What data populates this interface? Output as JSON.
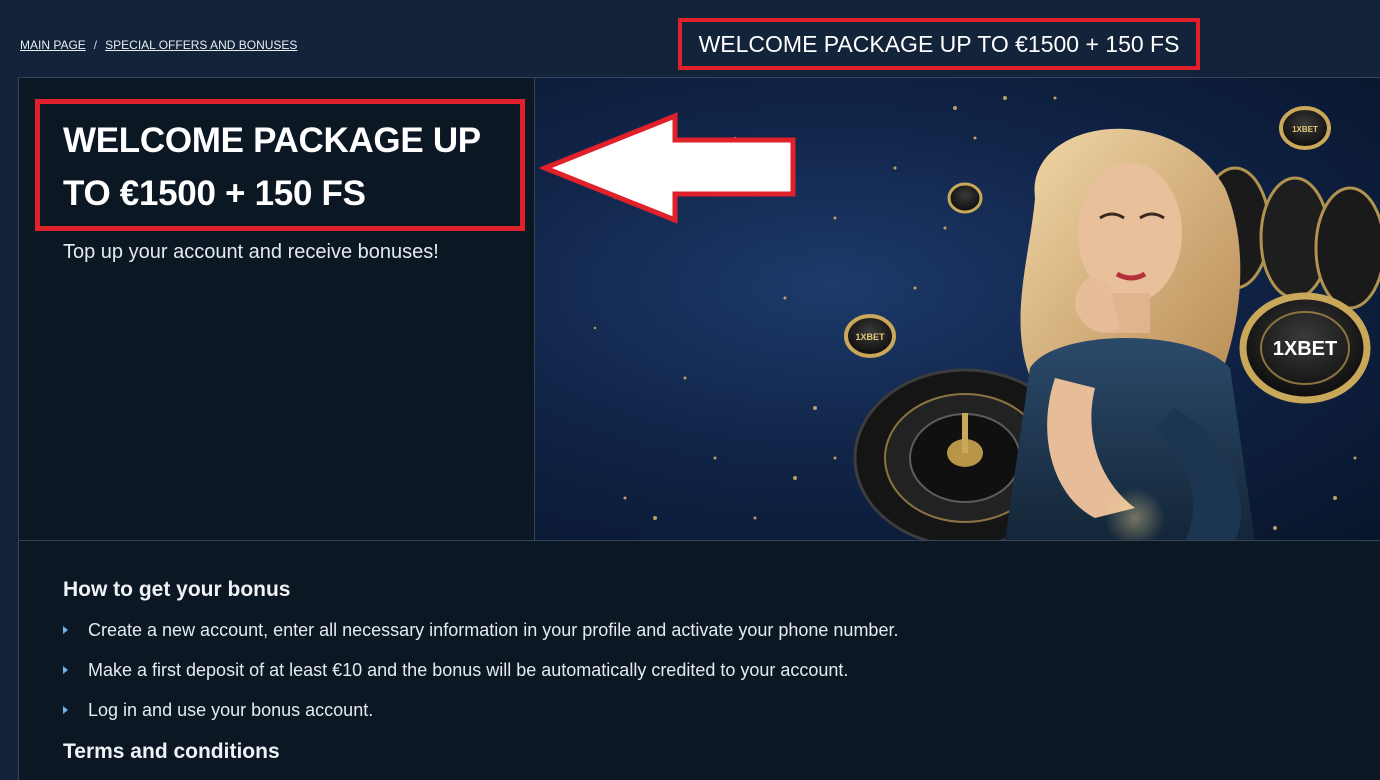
{
  "breadcrumb": {
    "items": [
      "MAIN PAGE",
      "SPECIAL OFFERS AND BONUSES"
    ],
    "separator": "/"
  },
  "header": {
    "title": "WELCOME PACKAGE UP TO €1500 + 150 FS"
  },
  "hero": {
    "title": "WELCOME PACKAGE UP TO €1500 + 150 FS",
    "subtitle": "Top up your account and receive bonuses!",
    "chip_label": "1XBET"
  },
  "how_to": {
    "heading": "How to get your bonus",
    "items": [
      "Create a new account, enter all necessary information in your profile and activate your phone number.",
      "Make a first deposit of at least €10 and the bonus will be automatically credited to your account.",
      "Log in and use your bonus account."
    ]
  },
  "terms": {
    "heading": "Terms and conditions"
  },
  "colors": {
    "highlight": "#e0202a",
    "page_bg": "#13233a",
    "card_bg": "#0c1724",
    "bullet": "#6fb2e6"
  }
}
